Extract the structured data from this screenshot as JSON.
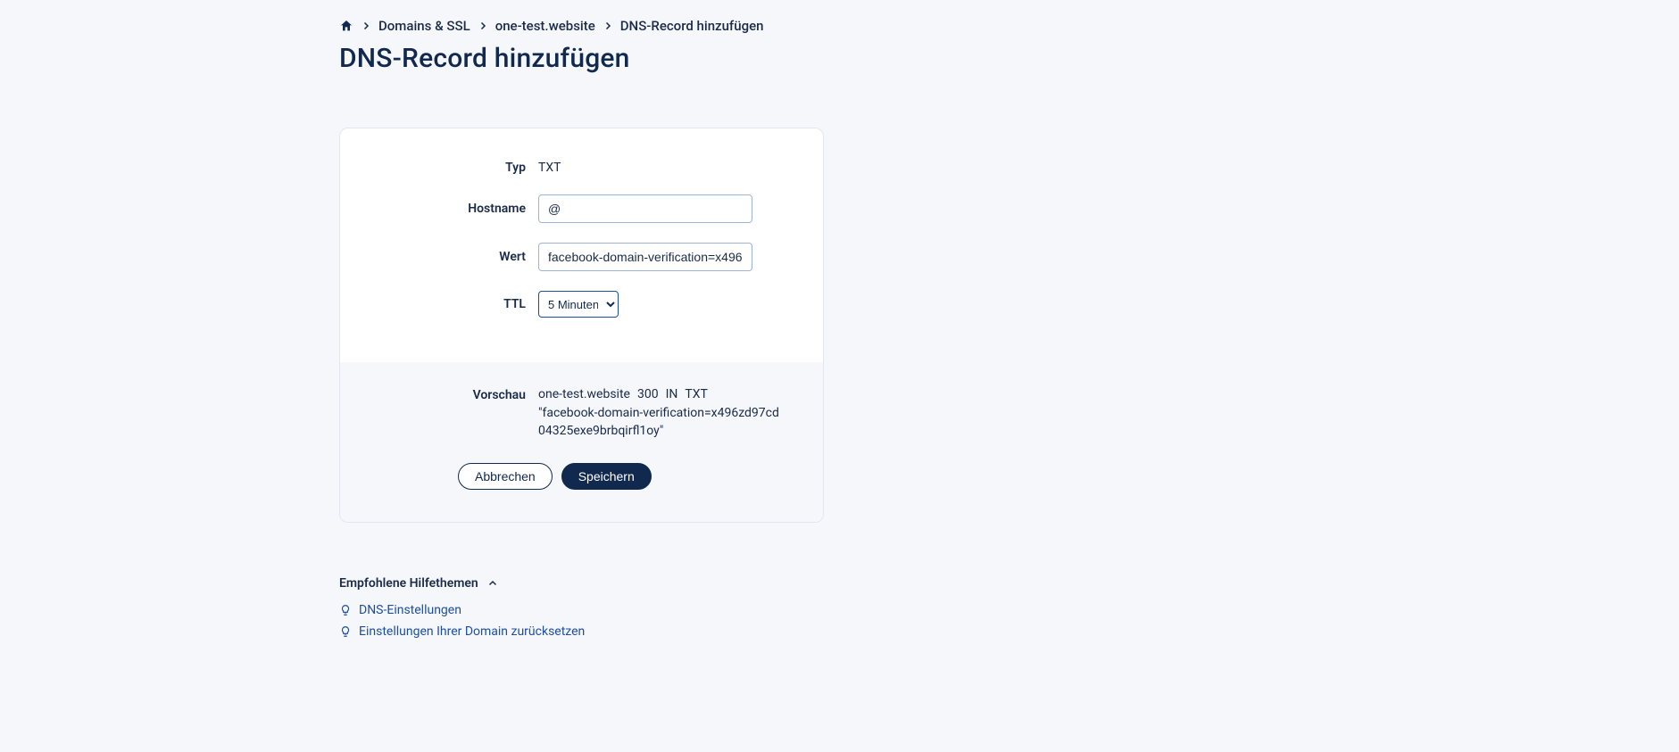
{
  "breadcrumb": {
    "home": "Home",
    "domains": "Domains & SSL",
    "domain_name": "one-test.website",
    "current": "DNS-Record hinzufügen"
  },
  "page_title": "DNS-Record hinzufügen",
  "form": {
    "type_label": "Typ",
    "type_value": "TXT",
    "hostname_label": "Hostname",
    "hostname_value": "@",
    "value_label": "Wert",
    "value_value": "facebook-domain-verification=x496zd97",
    "ttl_label": "TTL",
    "ttl_selected": "5 Minuten"
  },
  "preview": {
    "label": "Vorschau",
    "domain": "one-test.website",
    "ttl": "300",
    "class": "IN",
    "type": "TXT",
    "text": "\"facebook-domain-verification=x496zd97cd04325exe9brbqirfl1oy\""
  },
  "actions": {
    "cancel": "Abbrechen",
    "save": "Speichern"
  },
  "help": {
    "header": "Empfohlene Hilfethemen",
    "links": [
      "DNS-Einstellungen",
      "Einstellungen Ihrer Domain zurücksetzen"
    ]
  }
}
